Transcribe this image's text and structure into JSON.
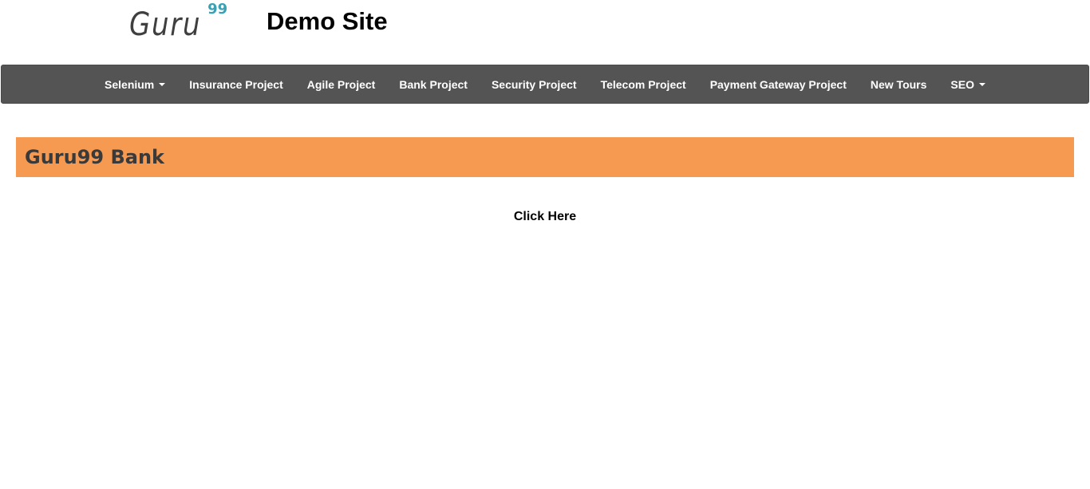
{
  "header": {
    "logo_text": "Guru",
    "logo_sup": "99",
    "site_title": "Demo Site"
  },
  "navbar": {
    "items": [
      {
        "label": "Selenium",
        "has_dropdown": true
      },
      {
        "label": "Insurance Project",
        "has_dropdown": false
      },
      {
        "label": "Agile Project",
        "has_dropdown": false
      },
      {
        "label": "Bank Project",
        "has_dropdown": false
      },
      {
        "label": "Security Project",
        "has_dropdown": false
      },
      {
        "label": "Telecom Project",
        "has_dropdown": false
      },
      {
        "label": "Payment Gateway Project",
        "has_dropdown": false
      },
      {
        "label": "New Tours",
        "has_dropdown": false
      },
      {
        "label": "SEO",
        "has_dropdown": true
      }
    ]
  },
  "main": {
    "bank_title": "Guru99 Bank",
    "click_here_label": "Click Here"
  },
  "colors": {
    "navbar_bg": "#545454",
    "banner_bg": "#f79a51",
    "logo_accent": "#3aa0b3"
  }
}
